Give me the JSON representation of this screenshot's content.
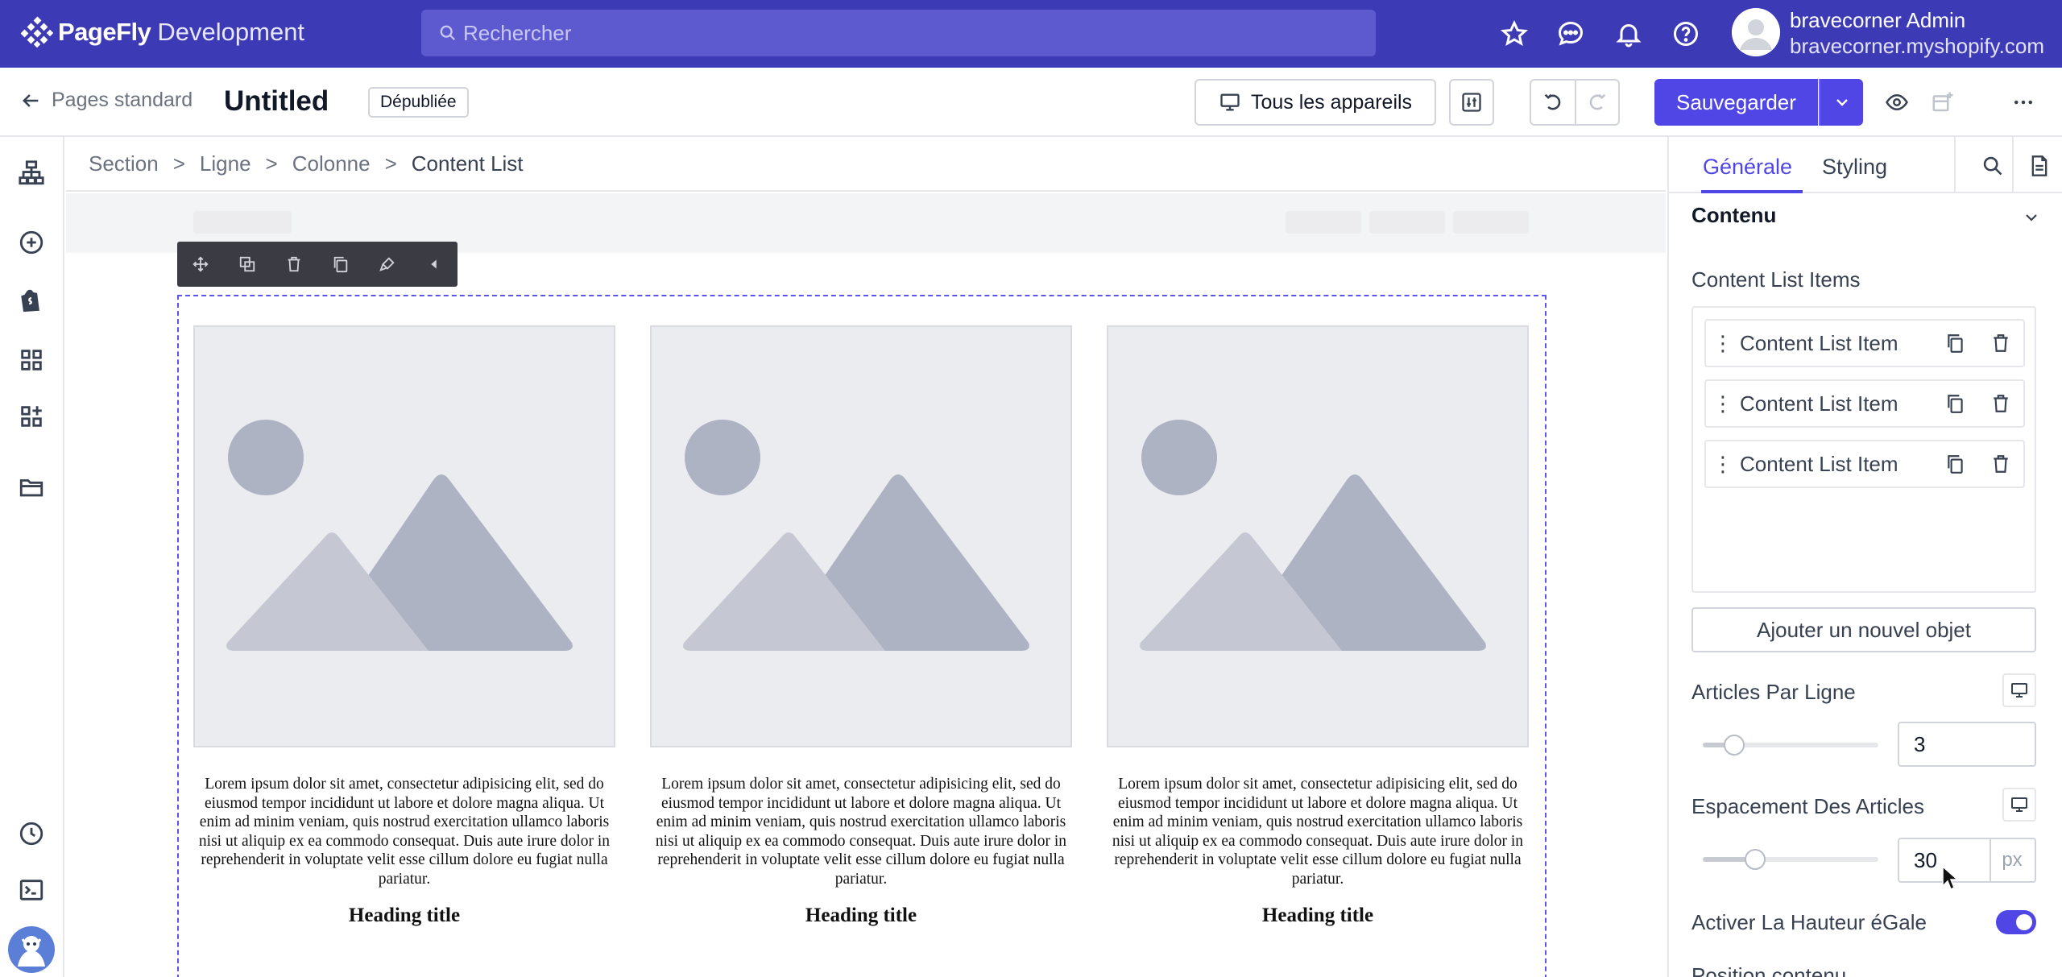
{
  "app": {
    "brand": "PageFly",
    "env": "Development",
    "search_placeholder": "Rechercher",
    "user_name": "bravecorner Admin",
    "user_shop": "bravecorner.myshopify.com"
  },
  "editor_bar": {
    "back_label": "Pages standard",
    "page_title": "Untitled",
    "status_badge": "Dépubliée",
    "device_label": "Tous les appareils",
    "save_label": "Sauvegarder"
  },
  "breadcrumb": [
    "Section",
    "Ligne",
    "Colonne",
    "Content List"
  ],
  "breadcrumb_sep": ">",
  "canvas": {
    "cards": [
      {
        "text": "Lorem ipsum dolor sit amet, consectetur adipisicing elit, sed do eiusmod tempor incididunt ut labore et dolore magna aliqua. Ut enim ad minim veniam, quis nostrud exercitation ullamco laboris nisi ut aliquip ex ea commodo consequat. Duis aute irure dolor in reprehenderit in voluptate velit esse cillum dolore eu fugiat nulla pariatur.",
        "heading": "Heading title"
      },
      {
        "text": "Lorem ipsum dolor sit amet, consectetur adipisicing elit, sed do eiusmod tempor incididunt ut labore et dolore magna aliqua. Ut enim ad minim veniam, quis nostrud exercitation ullamco laboris nisi ut aliquip ex ea commodo consequat. Duis aute irure dolor in reprehenderit in voluptate velit esse cillum dolore eu fugiat nulla pariatur.",
        "heading": "Heading title"
      },
      {
        "text": "Lorem ipsum dolor sit amet, consectetur adipisicing elit, sed do eiusmod tempor incididunt ut labore et dolore magna aliqua. Ut enim ad minim veniam, quis nostrud exercitation ullamco laboris nisi ut aliquip ex ea commodo consequat. Duis aute irure dolor in reprehenderit in voluptate velit esse cillum dolore eu fugiat nulla pariatur.",
        "heading": "Heading title"
      }
    ]
  },
  "panel": {
    "tabs": [
      "Générale",
      "Styling"
    ],
    "section_title": "Contenu",
    "items_label": "Content List Items",
    "items": [
      "Content List Item",
      "Content List Item",
      "Content List Item"
    ],
    "add_label": "Ajouter un nouvel objet",
    "per_row_label": "Articles Par Ligne",
    "per_row_value": "3",
    "spacing_label": "Espacement Des Articles",
    "spacing_value": "30",
    "spacing_unit": "px",
    "equal_height_label": "Activer La Hauteur éGale",
    "equal_height_on": true,
    "next_label": "Position contenu"
  },
  "colors": {
    "topbar": "#3d3ab5",
    "accent": "#4f46e5",
    "selection": "#5a55e8"
  }
}
